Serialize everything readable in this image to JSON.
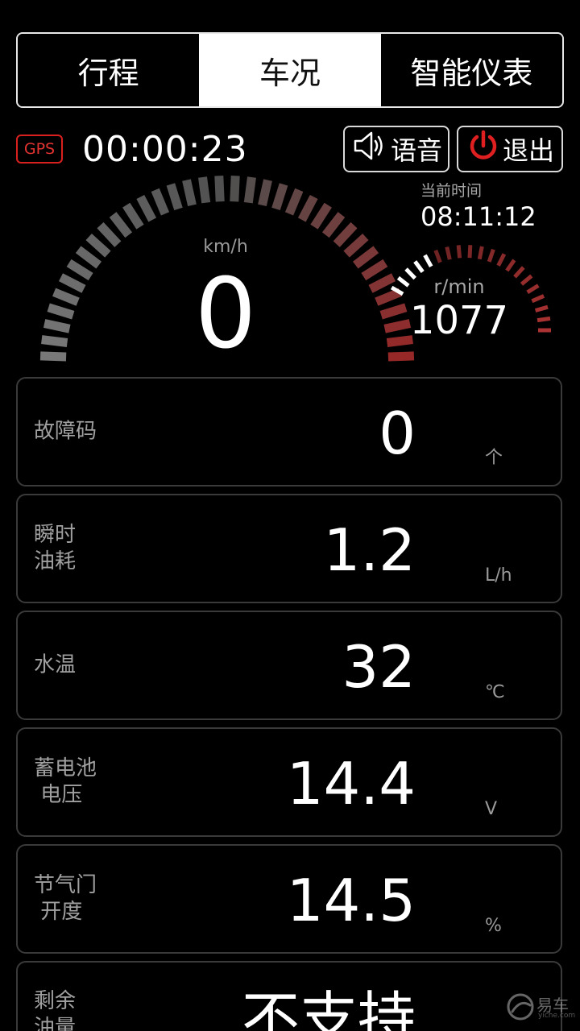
{
  "tabs": [
    {
      "label": "行程",
      "active": false
    },
    {
      "label": "车况",
      "active": true
    },
    {
      "label": "智能仪表",
      "active": false
    }
  ],
  "status": {
    "gps_label": "GPS",
    "elapsed_time": "00:00:23",
    "voice_label": "语音",
    "exit_label": "退出",
    "current_time_label": "当前时间",
    "current_time": "08:11:12"
  },
  "speed_gauge": {
    "unit": "km/h",
    "value": "0"
  },
  "rpm_gauge": {
    "unit": "r/min",
    "value": "1077"
  },
  "cards": [
    {
      "label": "故障码",
      "value": "0",
      "unit": "个"
    },
    {
      "label": "瞬时\n油耗",
      "value": "1.2",
      "unit": "L/h"
    },
    {
      "label": "水温",
      "value": "32",
      "unit": "℃"
    },
    {
      "label": "蓄电池\n 电压",
      "value": "14.4",
      "unit": "V"
    },
    {
      "label": "节气门\n 开度",
      "value": "14.5",
      "unit": "%"
    },
    {
      "label": "剩余\n油量",
      "value": "不支持",
      "unit": ""
    }
  ],
  "watermark": {
    "text": "易车",
    "sub": "yiche.com"
  },
  "colors": {
    "accent_red": "#d8211e",
    "background": "#000000",
    "tab_active_bg": "#ffffff"
  }
}
